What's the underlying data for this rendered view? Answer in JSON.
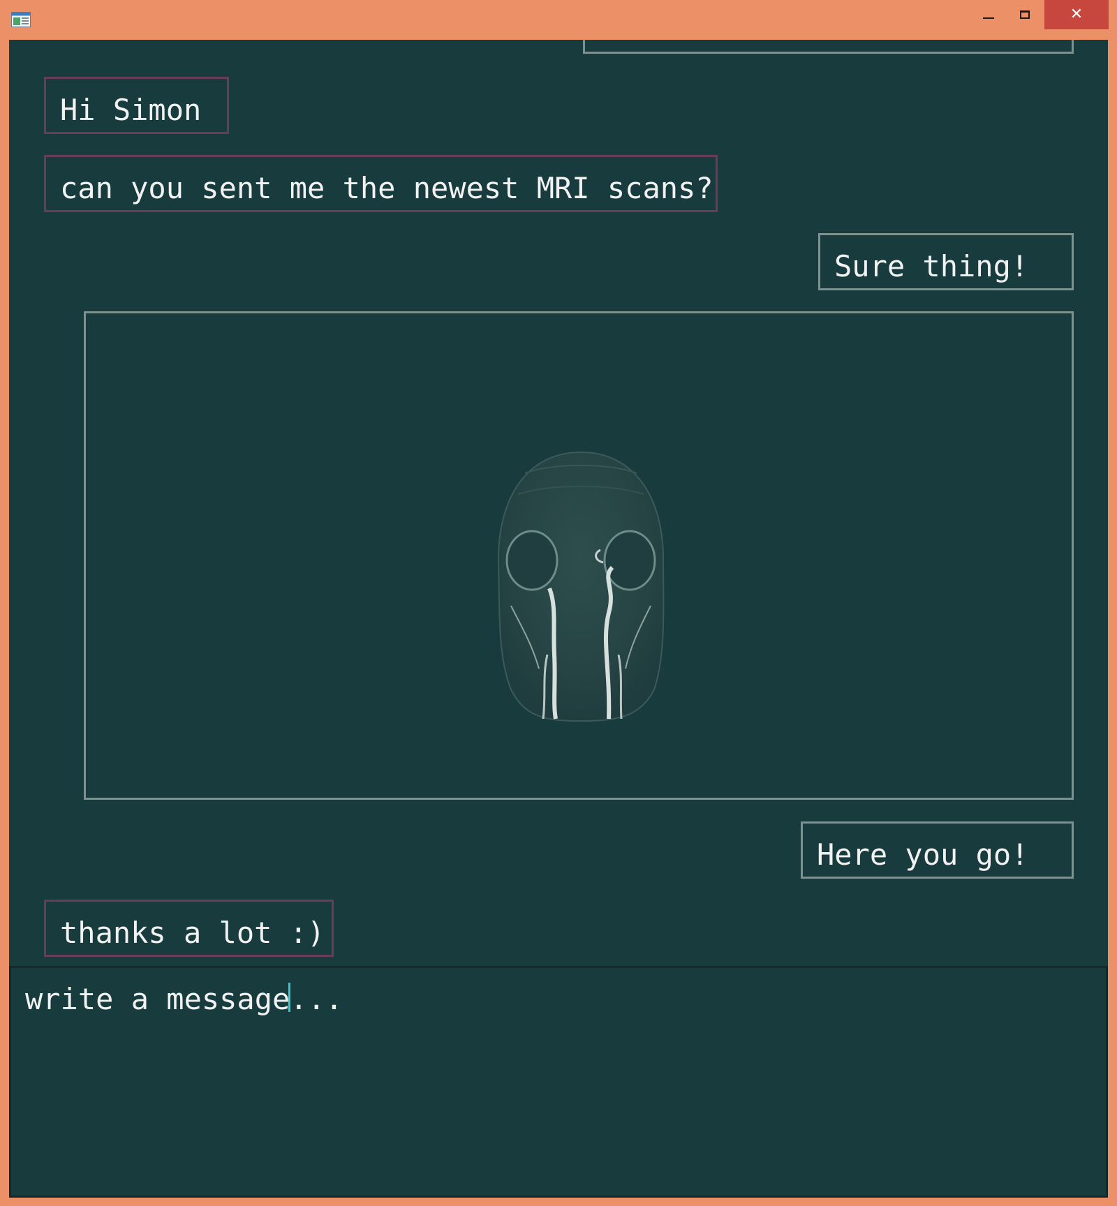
{
  "window": {
    "colors": {
      "frame": "#ec9068",
      "close_button": "#c7463d",
      "chat_background": "#183c3e",
      "incoming_border": "#6b3c58",
      "outgoing_border": "#7d9191"
    },
    "controls": {
      "minimize_icon": "minimize-icon",
      "maximize_icon": "maximize-icon",
      "close_icon": "close-icon",
      "close_glyph": "✕"
    }
  },
  "chat": {
    "messages": [
      {
        "side": "incoming",
        "text": "Hi Simon"
      },
      {
        "side": "incoming",
        "text": "can you sent me the newest MRI scans?"
      },
      {
        "side": "outgoing",
        "text": "Sure thing!"
      },
      {
        "side": "outgoing",
        "type": "image",
        "image_icon": "mri-scan-image"
      },
      {
        "side": "outgoing",
        "text": "Here you go!"
      },
      {
        "side": "incoming",
        "text": "thanks a lot :)"
      }
    ]
  },
  "composer": {
    "placeholder": "write a message..."
  }
}
